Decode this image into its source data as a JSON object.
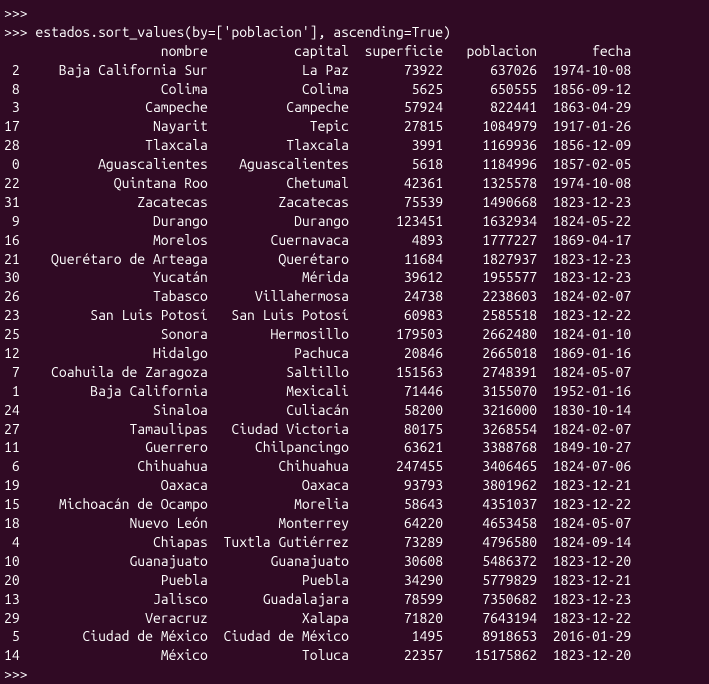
{
  "prompt1": ">>>",
  "command": ">>> estados.sort_values(by=['poblacion'], ascending=True)",
  "headers": {
    "index": "",
    "nombre": "nombre",
    "capital": "capital",
    "superficie": "superficie",
    "poblacion": "poblacion",
    "fecha": "fecha"
  },
  "chart_data": {
    "type": "table",
    "columns": [
      "index",
      "nombre",
      "capital",
      "superficie",
      "poblacion",
      "fecha"
    ],
    "rows": [
      {
        "index": "2",
        "nombre": "Baja California Sur",
        "capital": "La Paz",
        "superficie": "73922",
        "poblacion": "637026",
        "fecha": "1974-10-08"
      },
      {
        "index": "8",
        "nombre": "Colima",
        "capital": "Colima",
        "superficie": "5625",
        "poblacion": "650555",
        "fecha": "1856-09-12"
      },
      {
        "index": "3",
        "nombre": "Campeche",
        "capital": "Campeche",
        "superficie": "57924",
        "poblacion": "822441",
        "fecha": "1863-04-29"
      },
      {
        "index": "17",
        "nombre": "Nayarit",
        "capital": "Tepic",
        "superficie": "27815",
        "poblacion": "1084979",
        "fecha": "1917-01-26"
      },
      {
        "index": "28",
        "nombre": "Tlaxcala",
        "capital": "Tlaxcala",
        "superficie": "3991",
        "poblacion": "1169936",
        "fecha": "1856-12-09"
      },
      {
        "index": "0",
        "nombre": "Aguascalientes",
        "capital": "Aguascalientes",
        "superficie": "5618",
        "poblacion": "1184996",
        "fecha": "1857-02-05"
      },
      {
        "index": "22",
        "nombre": "Quintana Roo",
        "capital": "Chetumal",
        "superficie": "42361",
        "poblacion": "1325578",
        "fecha": "1974-10-08"
      },
      {
        "index": "31",
        "nombre": "Zacatecas",
        "capital": "Zacatecas",
        "superficie": "75539",
        "poblacion": "1490668",
        "fecha": "1823-12-23"
      },
      {
        "index": "9",
        "nombre": "Durango",
        "capital": "Durango",
        "superficie": "123451",
        "poblacion": "1632934",
        "fecha": "1824-05-22"
      },
      {
        "index": "16",
        "nombre": "Morelos",
        "capital": "Cuernavaca",
        "superficie": "4893",
        "poblacion": "1777227",
        "fecha": "1869-04-17"
      },
      {
        "index": "21",
        "nombre": "Querétaro de Arteaga",
        "capital": "Querétaro",
        "superficie": "11684",
        "poblacion": "1827937",
        "fecha": "1823-12-23"
      },
      {
        "index": "30",
        "nombre": "Yucatán",
        "capital": "Mérida",
        "superficie": "39612",
        "poblacion": "1955577",
        "fecha": "1823-12-23"
      },
      {
        "index": "26",
        "nombre": "Tabasco",
        "capital": "Villahermosa",
        "superficie": "24738",
        "poblacion": "2238603",
        "fecha": "1824-02-07"
      },
      {
        "index": "23",
        "nombre": "San Luis Potosí",
        "capital": "San Luis Potosí",
        "superficie": "60983",
        "poblacion": "2585518",
        "fecha": "1823-12-22"
      },
      {
        "index": "25",
        "nombre": "Sonora",
        "capital": "Hermosillo",
        "superficie": "179503",
        "poblacion": "2662480",
        "fecha": "1824-01-10"
      },
      {
        "index": "12",
        "nombre": "Hidalgo",
        "capital": "Pachuca",
        "superficie": "20846",
        "poblacion": "2665018",
        "fecha": "1869-01-16"
      },
      {
        "index": "7",
        "nombre": "Coahuila de Zaragoza",
        "capital": "Saltillo",
        "superficie": "151563",
        "poblacion": "2748391",
        "fecha": "1824-05-07"
      },
      {
        "index": "1",
        "nombre": "Baja California",
        "capital": "Mexicali",
        "superficie": "71446",
        "poblacion": "3155070",
        "fecha": "1952-01-16"
      },
      {
        "index": "24",
        "nombre": "Sinaloa",
        "capital": "Culiacán",
        "superficie": "58200",
        "poblacion": "3216000",
        "fecha": "1830-10-14"
      },
      {
        "index": "27",
        "nombre": "Tamaulipas",
        "capital": "Ciudad Victoria",
        "superficie": "80175",
        "poblacion": "3268554",
        "fecha": "1824-02-07"
      },
      {
        "index": "11",
        "nombre": "Guerrero",
        "capital": "Chilpancingo",
        "superficie": "63621",
        "poblacion": "3388768",
        "fecha": "1849-10-27"
      },
      {
        "index": "6",
        "nombre": "Chihuahua",
        "capital": "Chihuahua",
        "superficie": "247455",
        "poblacion": "3406465",
        "fecha": "1824-07-06"
      },
      {
        "index": "19",
        "nombre": "Oaxaca",
        "capital": "Oaxaca",
        "superficie": "93793",
        "poblacion": "3801962",
        "fecha": "1823-12-21"
      },
      {
        "index": "15",
        "nombre": "Michoacán de Ocampo",
        "capital": "Morelia",
        "superficie": "58643",
        "poblacion": "4351037",
        "fecha": "1823-12-22"
      },
      {
        "index": "18",
        "nombre": "Nuevo León",
        "capital": "Monterrey",
        "superficie": "64220",
        "poblacion": "4653458",
        "fecha": "1824-05-07"
      },
      {
        "index": "4",
        "nombre": "Chiapas",
        "capital": "Tuxtla Gutiérrez",
        "superficie": "73289",
        "poblacion": "4796580",
        "fecha": "1824-09-14"
      },
      {
        "index": "10",
        "nombre": "Guanajuato",
        "capital": "Guanajuato",
        "superficie": "30608",
        "poblacion": "5486372",
        "fecha": "1823-12-20"
      },
      {
        "index": "20",
        "nombre": "Puebla",
        "capital": "Puebla",
        "superficie": "34290",
        "poblacion": "5779829",
        "fecha": "1823-12-21"
      },
      {
        "index": "13",
        "nombre": "Jalisco",
        "capital": "Guadalajara",
        "superficie": "78599",
        "poblacion": "7350682",
        "fecha": "1823-12-23"
      },
      {
        "index": "29",
        "nombre": "Veracruz",
        "capital": "Xalapa",
        "superficie": "71820",
        "poblacion": "7643194",
        "fecha": "1823-12-22"
      },
      {
        "index": "5",
        "nombre": "Ciudad de México",
        "capital": "Ciudad de México",
        "superficie": "1495",
        "poblacion": "8918653",
        "fecha": "2016-01-29"
      },
      {
        "index": "14",
        "nombre": "México",
        "capital": "Toluca",
        "superficie": "22357",
        "poblacion": "15175862",
        "fecha": "1823-12-20"
      }
    ]
  },
  "prompt2": ">>>"
}
